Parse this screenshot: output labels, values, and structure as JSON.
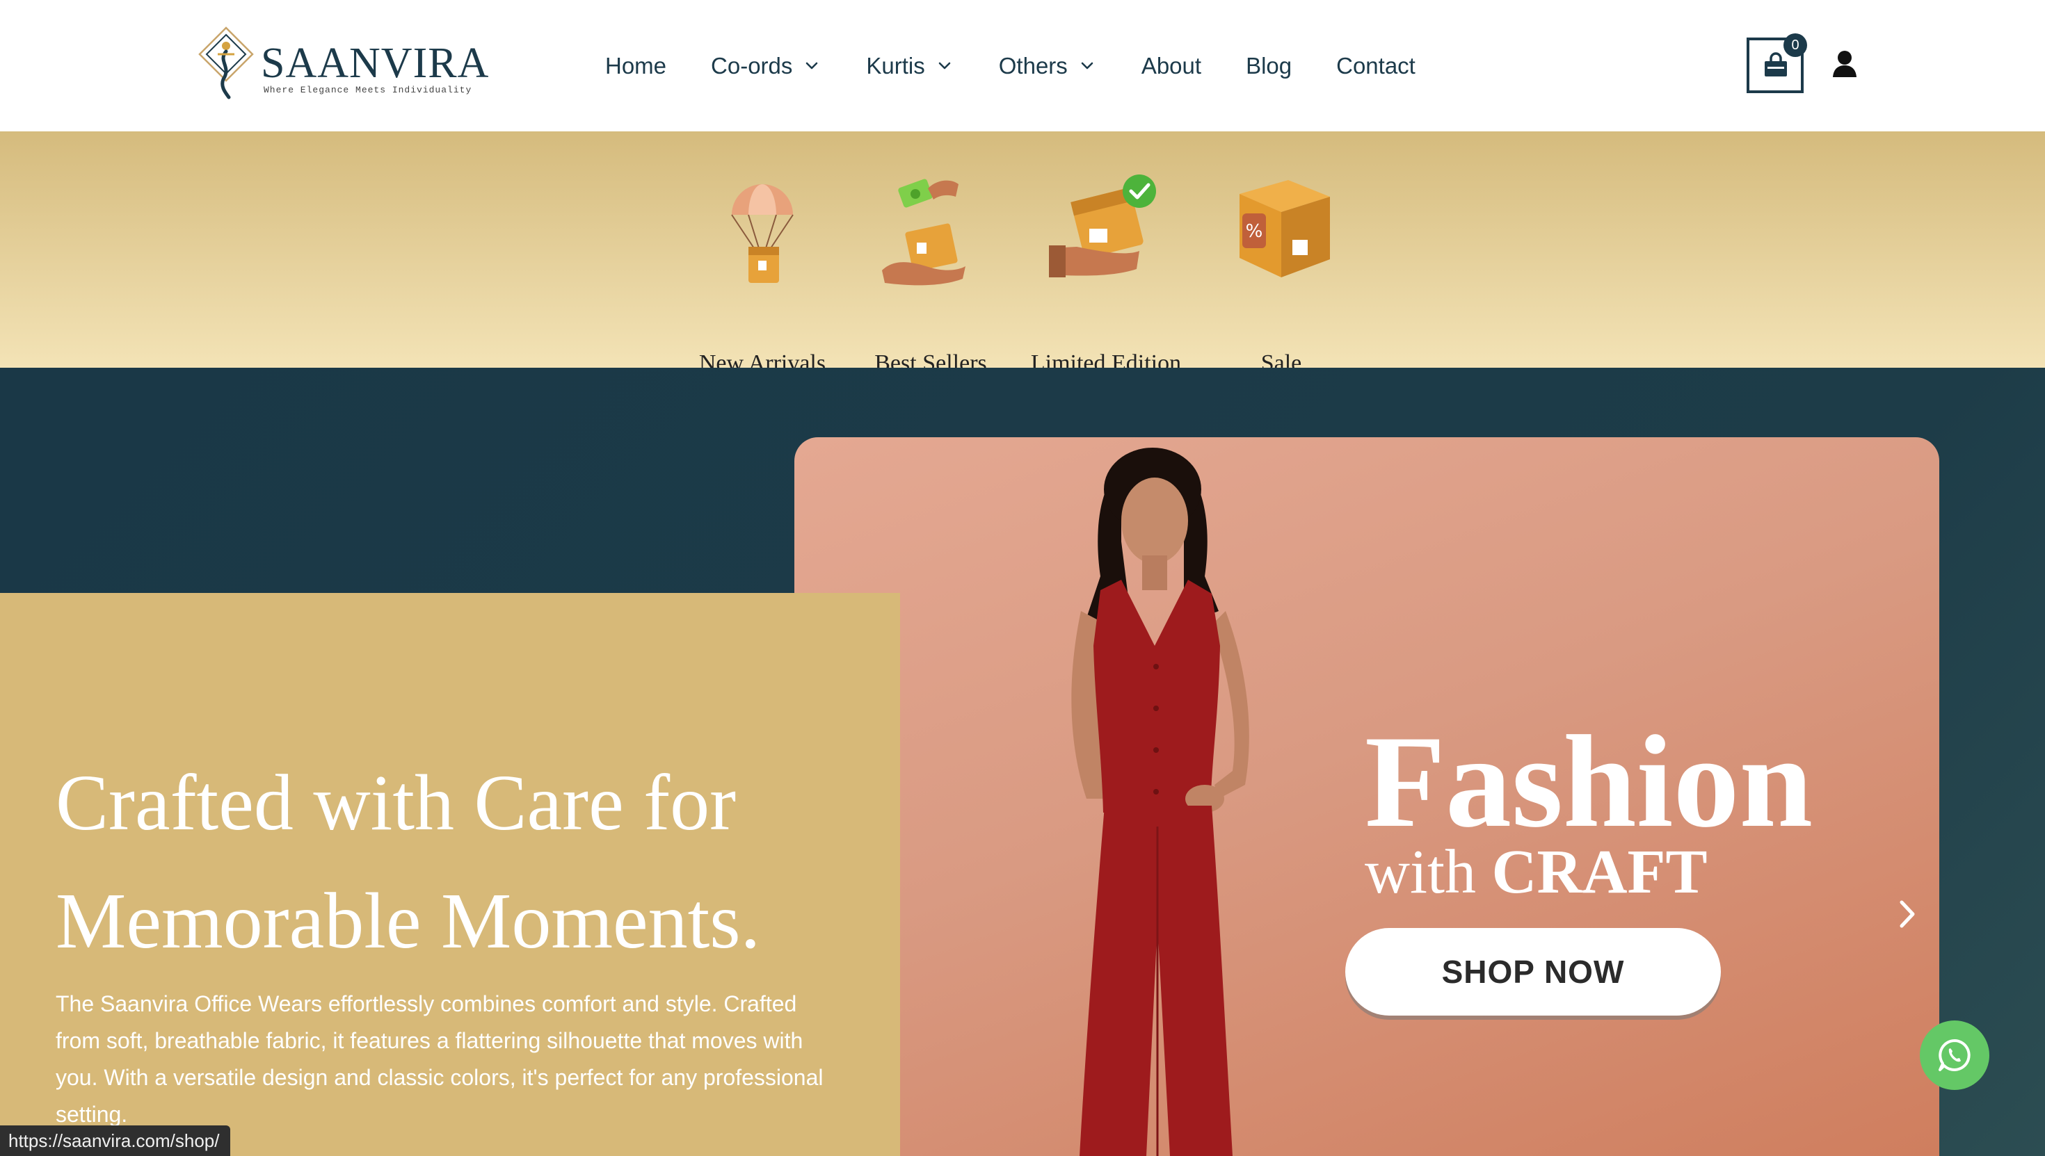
{
  "brand": {
    "name": "SAANVIRA",
    "tagline": "Where Elegance Meets Individuality"
  },
  "nav": {
    "items": [
      {
        "label": "Home",
        "has_dropdown": false
      },
      {
        "label": "Co-ords",
        "has_dropdown": true
      },
      {
        "label": "Kurtis",
        "has_dropdown": true
      },
      {
        "label": "Others",
        "has_dropdown": true
      },
      {
        "label": "About",
        "has_dropdown": false
      },
      {
        "label": "Blog",
        "has_dropdown": false
      },
      {
        "label": "Contact",
        "has_dropdown": false
      }
    ]
  },
  "cart": {
    "count": "0",
    "icon": "shopping-bag-icon"
  },
  "account": {
    "icon": "user-icon"
  },
  "categories": [
    {
      "label": "New Arrivals",
      "icon": "parachute-box-icon"
    },
    {
      "label": "Best Sellers",
      "icon": "hand-money-box-icon"
    },
    {
      "label": "Limited Edition",
      "icon": "hand-box-check-icon"
    },
    {
      "label": "Sale",
      "icon": "discount-box-icon"
    }
  ],
  "hero": {
    "headline_line1": "Crafted with Care for",
    "headline_line2": "Memorable Moments.",
    "description": "The Saanvira Office Wears effortlessly combines comfort and style. Crafted from soft, breathable fabric, it features a flattering silhouette that moves with you. With a versatile design and classic colors, it's perfect for any professional setting."
  },
  "banner": {
    "title": "Fashion",
    "sub_prefix": "with ",
    "sub_bold": "CRAFT",
    "cta": "SHOP NOW",
    "next_icon": "chevron-right-icon"
  },
  "whatsapp": {
    "icon": "whatsapp-icon"
  },
  "status_bar": {
    "url": "https://saanvira.com/shop/"
  },
  "colors": {
    "primary": "#1c3a4a",
    "gold": "#d7b978",
    "banner_bg": "#d99a82",
    "whatsapp": "#64c866"
  }
}
